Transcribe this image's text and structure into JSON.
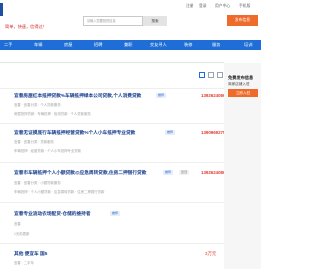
{
  "header": {
    "tagline": "简单，快速，信得过！",
    "search_placeholder": "请输入您要找的信息",
    "search_button": "搜索",
    "links": [
      "注册",
      "登录",
      "用户中心",
      "手机版"
    ],
    "post_button": "发布信息"
  },
  "nav": {
    "items": [
      "二手",
      "车辆",
      "房屋",
      "招聘",
      "兼职",
      "交友寻人",
      "装修",
      "服务",
      "培训"
    ]
  },
  "view_toggle": {
    "icons": [
      "grid-view-icon",
      "list-view-icon",
      "text-view-icon"
    ]
  },
  "listings": [
    {
      "title": "宜春房屋红本抵押贷款%车辆抵押绿本公司贷款,个人消费贷款",
      "badges": [
        "推荐"
      ],
      "phone": "13926240860",
      "meta": [
        "宜春 · 宜春分类 · 个人贷款服务",
        "房屋抵押贷款 · 车辆抵押 · 信用贷款 · 个人贷款服务"
      ]
    },
    {
      "title": "宜春无证摸底行车辆抵押经营贷款%个人小车抵押专业贷款",
      "badges": [
        "推荐"
      ],
      "phone": "13909692750",
      "meta": [
        "宜春 · 宜春分类 · 贷款服务",
        "车辆抵押 · 经营贷款 · 个人小车抵押专业贷款"
      ]
    },
    {
      "title": "宜春市车辆抵押个人小额贷款@应急周转贷款,住房二押银行贷款",
      "badges": [
        "推荐",
        "置顶"
      ],
      "phone": "13926240860",
      "meta": [
        "宜春 · 宜春分类 · 小额贷款服务",
        "车辆抵押 · 个人小额贷款 · 应急周转贷款 · 住房二押银行贷款"
      ]
    },
    {
      "title": "宜春专业流动农场配货·仓储的维持者",
      "badges": [
        "推荐"
      ],
      "phone": "",
      "meta": [
        "宜春",
        "1天前更新"
      ]
    },
    {
      "title": "其他 便宜车 国5",
      "badges": [],
      "phone": "",
      "price": "3万元",
      "meta": [
        "宜春 · 二手车",
        "刚刚更新"
      ]
    }
  ],
  "sidebar": {
    "title": "免费发布信息",
    "subtitle": "商家店铺入驻",
    "button": "立即入驻"
  }
}
